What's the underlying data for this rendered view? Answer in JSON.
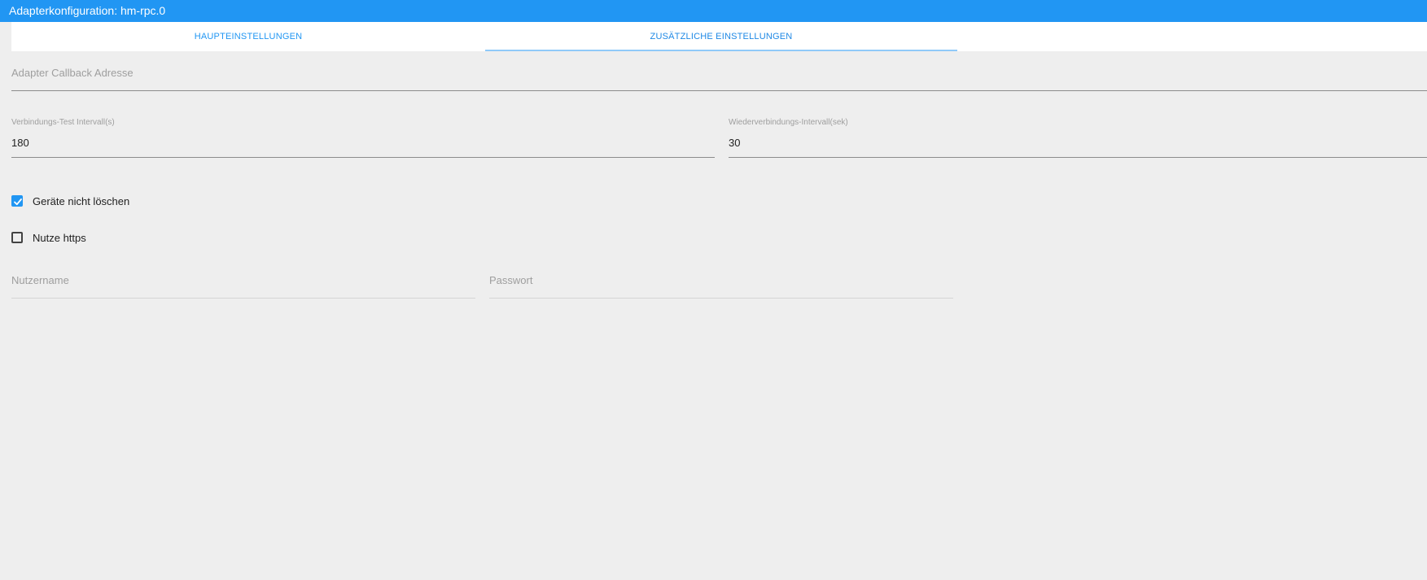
{
  "window": {
    "title": "Adapterkonfiguration: hm-rpc.0"
  },
  "tabs": [
    {
      "label": "HAUPTEINSTELLUNGEN",
      "active": false
    },
    {
      "label": "ZUSÄTZLICHE EINSTELLUNGEN",
      "active": true
    }
  ],
  "fields": {
    "callback": {
      "placeholder": "Adapter Callback Adresse",
      "value": ""
    },
    "test_interval": {
      "label": "Verbindungs-Test Intervall(s)",
      "value": "180"
    },
    "reconnect_interval": {
      "label": "Wiederverbindungs-Intervall(sek)",
      "value": "30"
    },
    "username": {
      "placeholder": "Nutzername",
      "value": ""
    },
    "password": {
      "placeholder": "Passwort",
      "value": ""
    }
  },
  "checkboxes": {
    "dont_delete": {
      "label": "Geräte nicht löschen",
      "checked": true
    },
    "use_https": {
      "label": "Nutze https",
      "checked": false
    }
  },
  "colors": {
    "accent": "#2196f3",
    "background": "#eeeeee",
    "tab_background": "#ffffff"
  }
}
